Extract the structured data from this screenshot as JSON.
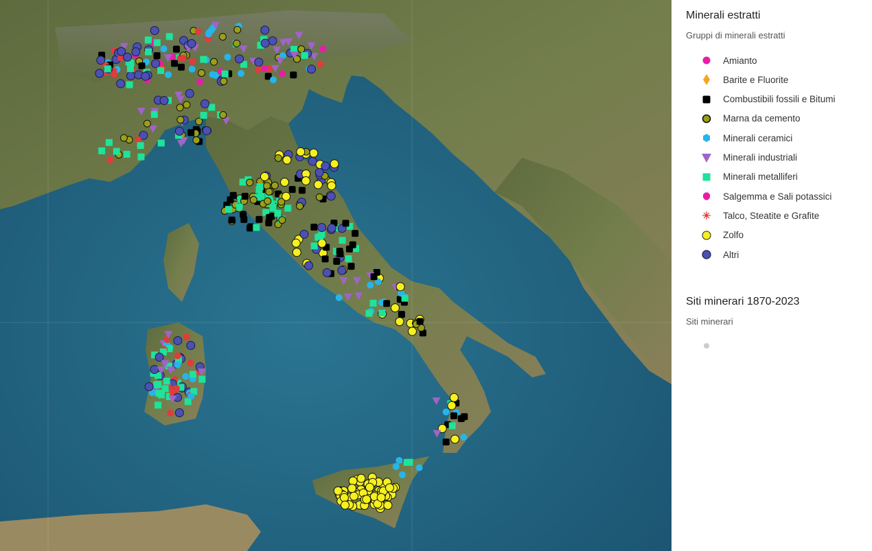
{
  "legend": {
    "group1": {
      "title": "Minerali estratti",
      "subtitle": "Gruppi di minerali estratti",
      "items": [
        {
          "label": "Amianto",
          "icon": "pink-circle-icon",
          "color": "#e61ea6"
        },
        {
          "label": "Barite e Fluorite",
          "icon": "orange-diamond-icon",
          "color": "#f5a623"
        },
        {
          "label": "Combustibili fossili e Bitumi",
          "icon": "black-square-icon",
          "color": "#000000"
        },
        {
          "label": "Marna da cemento",
          "icon": "olive-circle-icon",
          "color": "#9aa016"
        },
        {
          "label": "Minerali ceramici",
          "icon": "cyan-hexagon-icon",
          "color": "#26b5ea"
        },
        {
          "label": "Minerali industriali",
          "icon": "purple-triangle-icon",
          "color": "#a064c8"
        },
        {
          "label": "Minerali metalliferi",
          "icon": "green-square-icon",
          "color": "#1ee39a"
        },
        {
          "label": "Salgemma e Sali potassici",
          "icon": "magenta-octagon-icon",
          "color": "#e61ea6"
        },
        {
          "label": "Talco, Steatite e Grafite",
          "icon": "red-star-icon",
          "color": "#e03c3c"
        },
        {
          "label": "Zolfo",
          "icon": "yellow-circle-icon",
          "color": "#f5f01e"
        },
        {
          "label": "Altri",
          "icon": "navy-circle-icon",
          "color": "#4b50b4"
        }
      ]
    },
    "group2": {
      "title": "Siti minerari 1870-2023",
      "subtitle": "Siti minerari",
      "items": [
        {
          "label": "",
          "icon": "gray-dot-icon",
          "color": "#cccccc"
        }
      ]
    }
  },
  "map": {
    "basemap": "satellite imagery",
    "sea_color": "#1f5f7a",
    "land_color": "#6b7a45"
  }
}
